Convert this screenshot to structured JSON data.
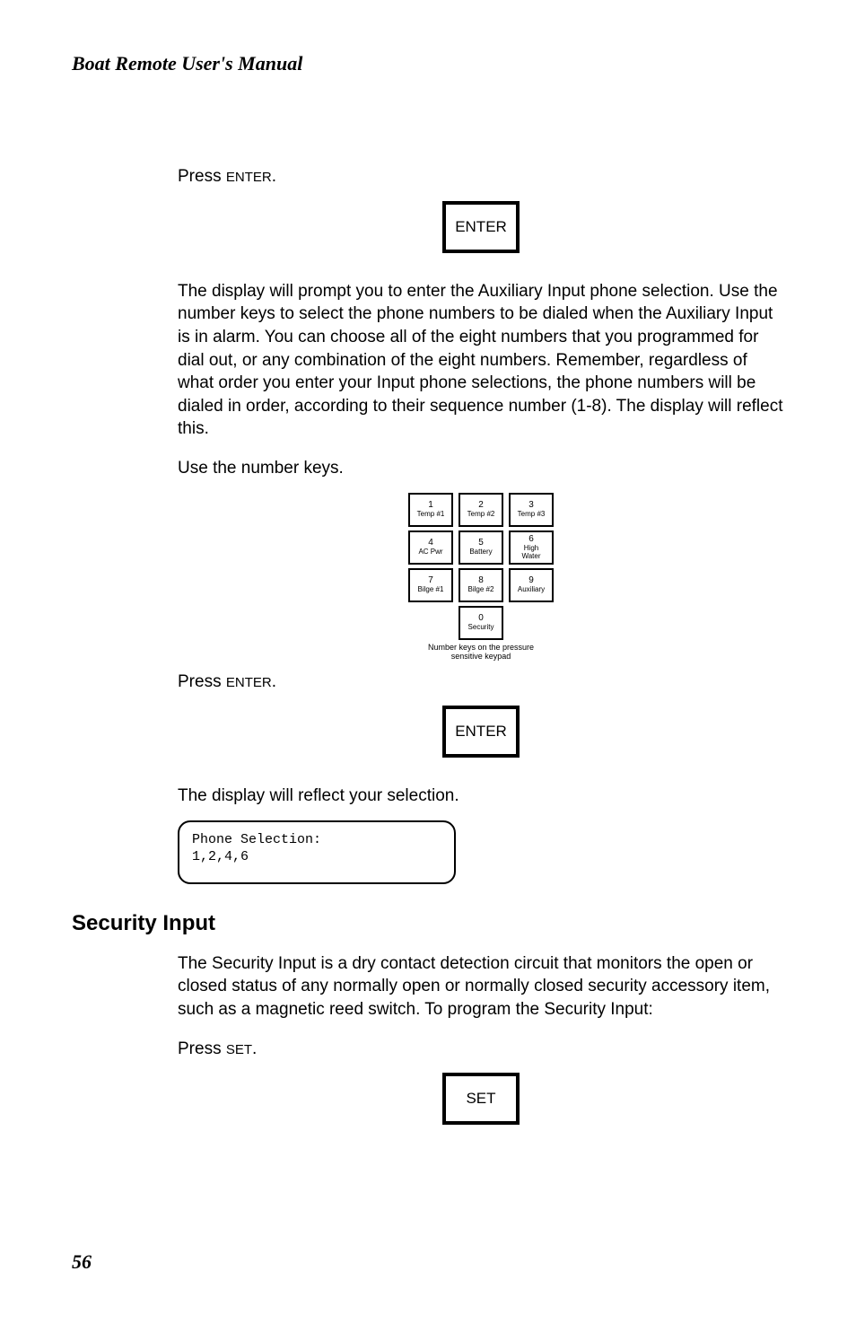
{
  "header": "Boat Remote User's Manual",
  "press_enter": "Press ",
  "enter_sc": "ENTER",
  "period": ".",
  "enter_box": "ENTER",
  "para1": "The display will prompt you to enter the Auxiliary Input phone selection. Use the number keys to select the phone numbers to be dialed when the Auxiliary Input is in alarm. You can choose all of the eight numbers that you programmed for dial out, or any combination of the eight numbers. Remember, regardless of what order you enter your Input phone selections, the phone numbers will be dialed in order, according to their sequence number (1-8). The display will reflect this.",
  "use_number_keys": "Use the number keys.",
  "keypad": {
    "rows": [
      [
        {
          "n": "1",
          "l": "Temp #1"
        },
        {
          "n": "2",
          "l": "Temp #2"
        },
        {
          "n": "3",
          "l": "Temp #3"
        }
      ],
      [
        {
          "n": "4",
          "l": "AC Pwr"
        },
        {
          "n": "5",
          "l": "Battery"
        },
        {
          "n": "6",
          "l": "High\nWater"
        }
      ],
      [
        {
          "n": "7",
          "l": "Bilge #1"
        },
        {
          "n": "8",
          "l": "Bilge #2"
        },
        {
          "n": "9",
          "l": "Auxiliary"
        }
      ],
      [
        {
          "n": "0",
          "l": "Security"
        }
      ]
    ],
    "caption1": "Number keys on the pressure",
    "caption2": "sensitive keypad"
  },
  "display_reflect": "The display will reflect your selection.",
  "lcd_line1": "Phone Selection:",
  "lcd_line2": "1,2,4,6",
  "security_input_heading": "Security Input",
  "security_para": "The Security Input is a dry contact detection circuit that monitors the open or closed status of any normally open or normally closed security accessory item, such as a magnetic reed switch. To program the Security Input:",
  "press_set": "Press ",
  "set_sc": "SET",
  "set_box": "SET",
  "page_number": "56"
}
